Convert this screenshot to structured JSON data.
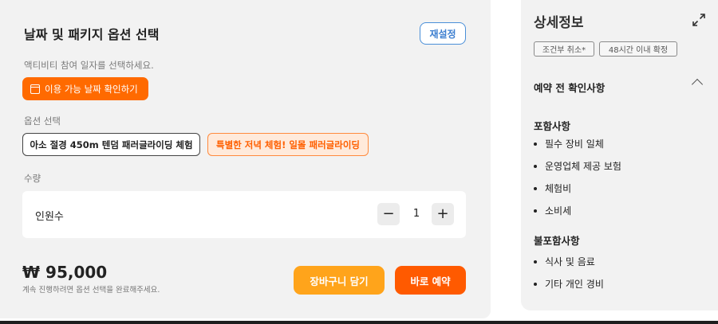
{
  "options_panel": {
    "title": "날짜 및 패키지 옵션 선택",
    "reset_label": "재설정",
    "date_hint": "액티비티 참여 일자를 선택하세요.",
    "date_button_label": "이용 가능 날짜 확인하기",
    "option_label": "옵션 선택",
    "options": [
      {
        "label": "아소 절경 450m 텐덤 패러글라이딩 체험",
        "selected": false
      },
      {
        "label": "특별한 저녁 체험! 일몰 패러글라이딩",
        "selected": true
      }
    ],
    "quantity_label": "수량",
    "quantity_item_name": "인원수",
    "quantity_value": "1",
    "minus_symbol": "−",
    "plus_symbol": "+",
    "price": "₩ 95,000",
    "price_note": "계속 진행하려면 옵션 선택을 완료해주세요.",
    "cart_button_label": "장바구니 담기",
    "book_button_label": "바로 예약"
  },
  "detail_panel": {
    "title": "상세정보",
    "tags": [
      "조건부 취소*",
      "48시간 이내 확정"
    ],
    "precheck_title": "예약 전 확인사항",
    "included_title": "포함사항",
    "included_items": [
      "필수 장비 일체",
      "운영업체 제공 보험",
      "체험비",
      "소비세"
    ],
    "excluded_title": "불포함사항",
    "excluded_items": [
      "식사 및 음료",
      "기타 개인 경비"
    ]
  },
  "colors": {
    "accent_orange": "#ff6a00",
    "cart_orange": "#ffa41b",
    "reset_blue": "#3d7fd0",
    "panel_bg": "#f2f2f2"
  },
  "icons": [
    "calendar-icon",
    "expand-icon",
    "chevron-up-icon",
    "bullet-icon"
  ]
}
